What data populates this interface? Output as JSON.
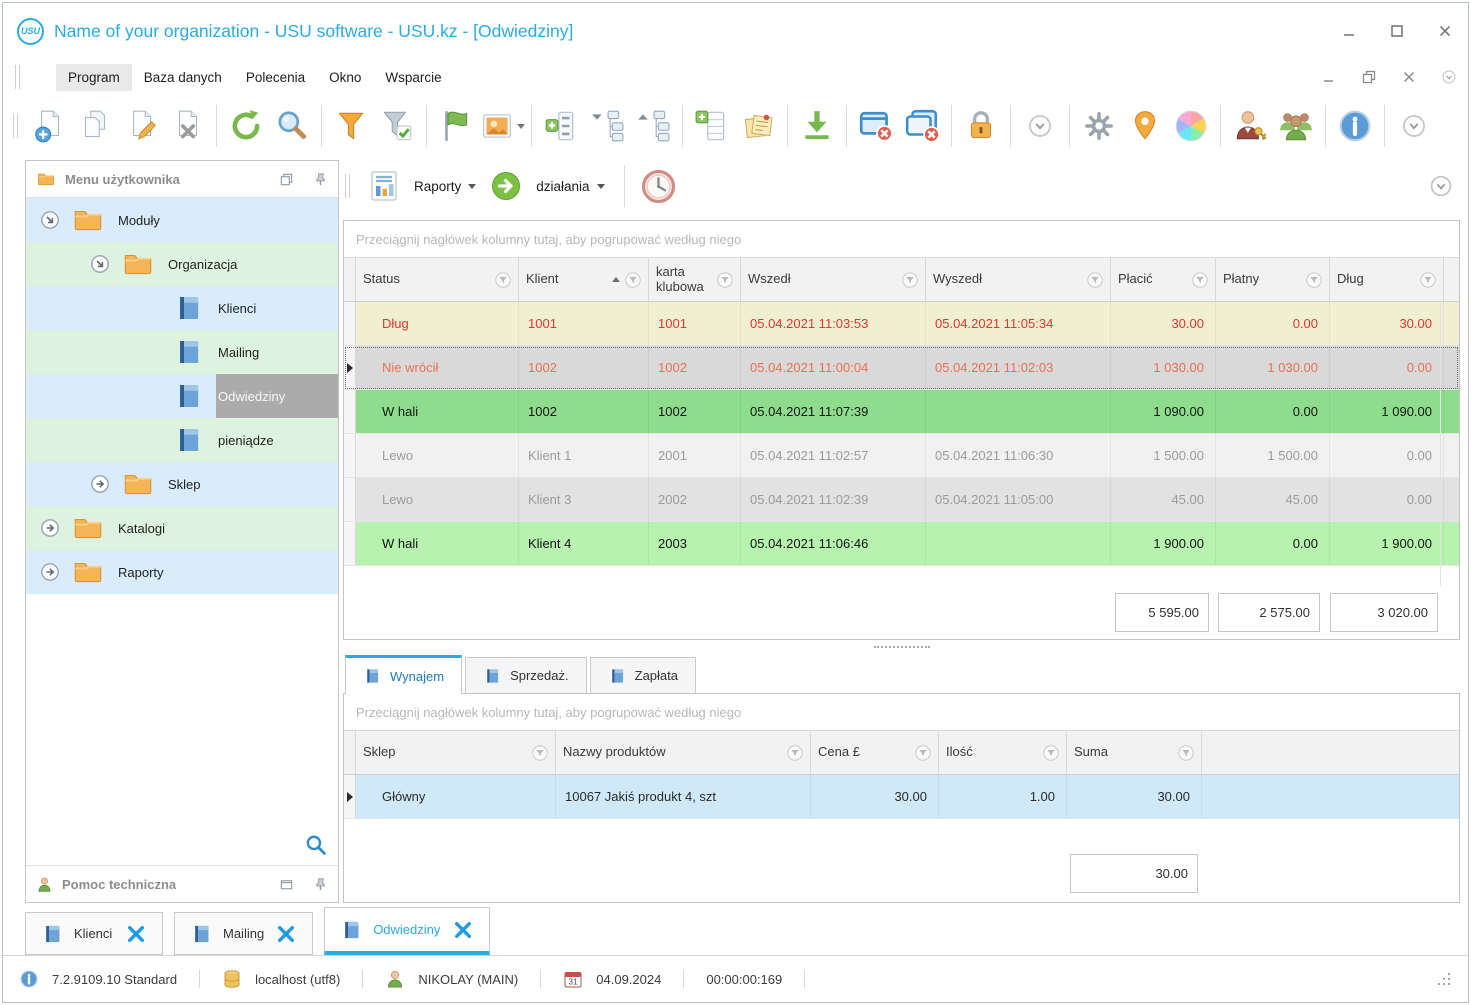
{
  "window": {
    "logo_text": "USU",
    "title": "Name of your organization - USU software - USU.kz - [Odwiedziny]"
  },
  "colors": {
    "accent": "#29abe3",
    "tree_blue": "#d8ecfb",
    "tree_green": "#def3df",
    "row_debt_bg": "#f1efd2",
    "row_debt_text": "#e5352b",
    "row_selected_bg": "#d9d9d9",
    "row_selected_text": "#ee6f50",
    "row_inhall_bg": "#8edd8d",
    "row_inhall_light_bg": "#b5f3ae",
    "row_left_text": "#9b9b9b"
  },
  "menubar": {
    "active_item": "Program",
    "items": [
      "Program",
      "Baza danych",
      "Polecenia",
      "Okno",
      "Wsparcie"
    ]
  },
  "toolbar": {
    "groups": [
      [
        "add-document",
        "copy-document",
        "edit-document",
        "delete-document"
      ],
      [
        "refresh",
        "search"
      ],
      [
        "filter",
        "filter-check"
      ],
      [
        "flag",
        "image"
      ],
      [
        "expand-rows",
        "tree-expand",
        "tree-collapse"
      ],
      [
        "add-table",
        "notes"
      ],
      [
        "download"
      ],
      [
        "close-window",
        "close-all-windows"
      ],
      [
        "lock"
      ],
      [
        "chevron-overflow"
      ],
      [
        "gear",
        "location-pin",
        "color-wheel"
      ],
      [
        "user-key",
        "users-group"
      ],
      [
        "info"
      ],
      [
        "chevron-overflow"
      ]
    ]
  },
  "sidebar": {
    "title": "Menu użytkownika",
    "footer_title": "Pomoc techniczna",
    "tree": [
      {
        "label": "Moduły",
        "level": 0,
        "icon": "folder",
        "expander": "expanded",
        "tone": "blue",
        "selected": false
      },
      {
        "label": "Organizacja",
        "level": 1,
        "icon": "folder",
        "expander": "expanded",
        "tone": "green",
        "selected": false
      },
      {
        "label": "Klienci",
        "level": 2,
        "icon": "book",
        "expander": "none",
        "tone": "blue",
        "selected": false
      },
      {
        "label": "Mailing",
        "level": 2,
        "icon": "book",
        "expander": "none",
        "tone": "green",
        "selected": false
      },
      {
        "label": "Odwiedziny",
        "level": 2,
        "icon": "book",
        "expander": "none",
        "tone": "blue",
        "selected": true
      },
      {
        "label": "pieniądze",
        "level": 2,
        "icon": "book",
        "expander": "none",
        "tone": "green",
        "selected": false
      },
      {
        "label": "Sklep",
        "level": 1,
        "icon": "folder",
        "expander": "collapsed",
        "tone": "blue",
        "selected": false
      },
      {
        "label": "Katalogi",
        "level": 0,
        "icon": "folder",
        "expander": "collapsed",
        "tone": "green",
        "selected": false
      },
      {
        "label": "Raporty",
        "level": 0,
        "icon": "folder",
        "expander": "collapsed",
        "tone": "blue",
        "selected": false
      }
    ]
  },
  "report_bar": {
    "reports_label": "Raporty",
    "actions_label": "działania"
  },
  "visits_grid": {
    "group_hint": "Przeciągnij nagłówek kolumny tutaj, aby pogrupować według niego",
    "columns": [
      {
        "label": "Status",
        "field": "status",
        "sorted": "none",
        "numeric": false
      },
      {
        "label": "Klient",
        "field": "klient",
        "sorted": "asc",
        "numeric": false
      },
      {
        "label": "karta klubowa",
        "field": "karta",
        "sorted": "none",
        "numeric": false
      },
      {
        "label": "Wszedł",
        "field": "wszedl",
        "sorted": "none",
        "numeric": false
      },
      {
        "label": "Wyszedł",
        "field": "wyszedl",
        "sorted": "none",
        "numeric": false
      },
      {
        "label": "Płacić",
        "field": "placic",
        "sorted": "none",
        "numeric": true
      },
      {
        "label": "Płatny",
        "field": "platny",
        "sorted": "none",
        "numeric": true
      },
      {
        "label": "Dług",
        "field": "dlug",
        "sorted": "none",
        "numeric": true
      }
    ],
    "rows": [
      {
        "status": "Dług",
        "klient": "1001",
        "karta": "1001",
        "wszedl": "05.04.2021 11:03:53",
        "wyszedl": "05.04.2021 11:05:34",
        "placic": "30.00",
        "platny": "0.00",
        "dlug": "30.00",
        "style": "debt",
        "selected": false
      },
      {
        "status": "Nie wrócił",
        "klient": "1002",
        "karta": "1002",
        "wszedl": "05.04.2021 11:00:04",
        "wyszedl": "05.04.2021 11:02:03",
        "placic": "1 030.00",
        "platny": "1 030.00",
        "dlug": "0.00",
        "style": "not-returned",
        "selected": true
      },
      {
        "status": "W hali",
        "klient": "1002",
        "karta": "1002",
        "wszedl": "05.04.2021 11:07:39",
        "wyszedl": "",
        "placic": "1 090.00",
        "platny": "0.00",
        "dlug": "1 090.00",
        "style": "in-hall",
        "selected": false
      },
      {
        "status": "Lewo",
        "klient": "Klient 1",
        "karta": "2001",
        "wszedl": "05.04.2021 11:02:57",
        "wyszedl": "05.04.2021 11:06:30",
        "placic": "1 500.00",
        "platny": "1 500.00",
        "dlug": "0.00",
        "style": "left-a",
        "selected": false
      },
      {
        "status": "Lewo",
        "klient": "Klient 3",
        "karta": "2002",
        "wszedl": "05.04.2021 11:02:39",
        "wyszedl": "05.04.2021 11:05:00",
        "placic": "45.00",
        "platny": "45.00",
        "dlug": "0.00",
        "style": "left-b",
        "selected": false
      },
      {
        "status": "W hali",
        "klient": "Klient 4",
        "karta": "2003",
        "wszedl": "05.04.2021 11:06:46",
        "wyszedl": "",
        "placic": "1 900.00",
        "platny": "0.00",
        "dlug": "1 900.00",
        "style": "in-hall-light",
        "selected": false
      }
    ],
    "totals": {
      "placic": "5 595.00",
      "platny": "2 575.00",
      "dlug": "3 020.00"
    }
  },
  "detail_tabs": [
    {
      "label": "Wynajem",
      "active": true
    },
    {
      "label": "Sprzedaż.",
      "active": false
    },
    {
      "label": "Zapłata",
      "active": false
    }
  ],
  "products_grid": {
    "group_hint": "Przeciągnij nagłówek kolumny tutaj, aby pogrupować według niego",
    "columns": [
      {
        "label": "Sklep",
        "field": "sklep",
        "sorted": "none",
        "numeric": false
      },
      {
        "label": "Nazwy produktów",
        "field": "nazwa",
        "sorted": "none",
        "numeric": false
      },
      {
        "label": "Cena £",
        "field": "cena",
        "sorted": "none",
        "numeric": true
      },
      {
        "label": "Ilość",
        "field": "ilosc",
        "sorted": "none",
        "numeric": true
      },
      {
        "label": "Suma",
        "field": "suma",
        "sorted": "none",
        "numeric": true
      }
    ],
    "rows": [
      {
        "sklep": "Główny",
        "nazwa": "10067 Jakiś produkt 4, szt",
        "cena": "30.00",
        "ilosc": "1.00",
        "suma": "30.00",
        "style": "product",
        "selected": true
      }
    ],
    "total_suma": "30.00"
  },
  "mdi_tabs": [
    {
      "label": "Klienci",
      "active": false
    },
    {
      "label": "Mailing",
      "active": false
    },
    {
      "label": "Odwiedziny",
      "active": true
    }
  ],
  "statusbar": {
    "version": "7.2.9109.10 Standard",
    "database": "localhost (utf8)",
    "user": "NIKOLAY (MAIN)",
    "calendar_day": "31",
    "date": "04.09.2024",
    "timer": "00:00:00:169"
  }
}
